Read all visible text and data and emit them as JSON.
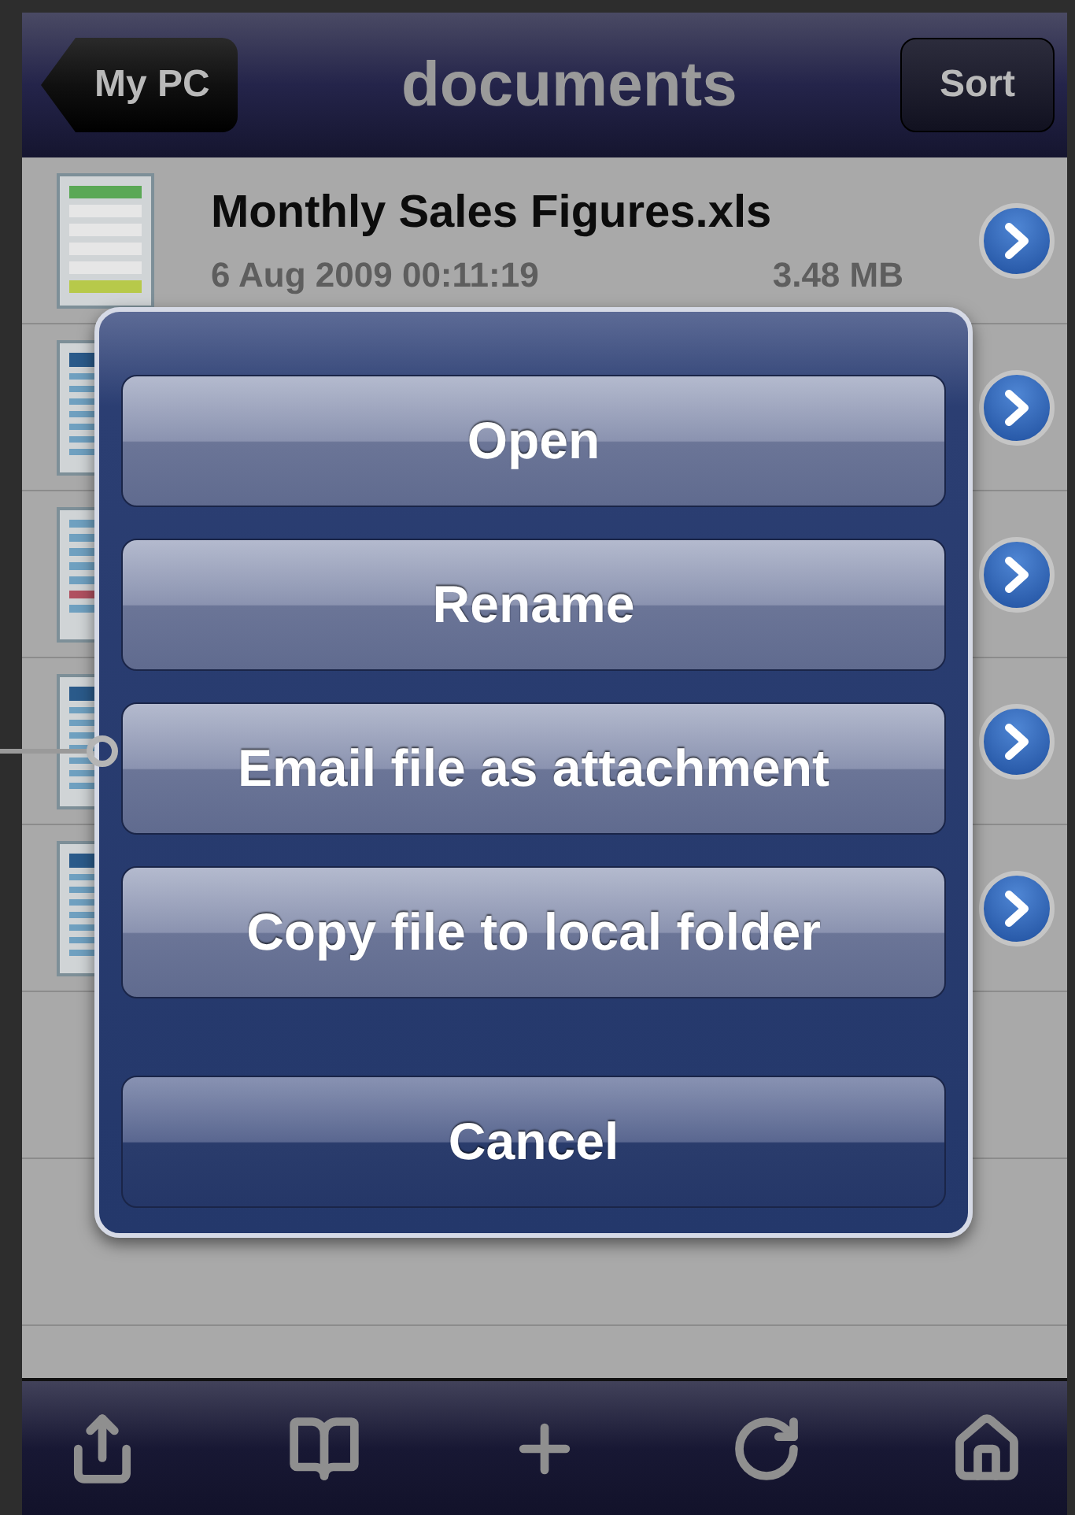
{
  "nav": {
    "back": "My PC",
    "title": "documents",
    "action": "Sort"
  },
  "files": [
    {
      "kind": "spreadsheet",
      "name": "Monthly Sales Figures.xls",
      "date": "6 Aug 2009 00:11:19",
      "size": "3.48 MB"
    },
    {
      "kind": "document"
    },
    {
      "kind": "presentation"
    },
    {
      "kind": "document"
    },
    {
      "kind": "document"
    }
  ],
  "sheet": {
    "actions": [
      {
        "label": "Open",
        "kind": "default"
      },
      {
        "label": "Rename",
        "kind": "default"
      },
      {
        "label": "Email file as attachment",
        "kind": "default"
      },
      {
        "label": "Copy file to local folder",
        "kind": "default"
      },
      {
        "label": "Cancel",
        "kind": "cancel"
      }
    ]
  },
  "toolbar": [
    {
      "kind": "share"
    },
    {
      "kind": "bookmarks"
    },
    {
      "kind": "add"
    },
    {
      "kind": "refresh"
    },
    {
      "kind": "home"
    }
  ]
}
